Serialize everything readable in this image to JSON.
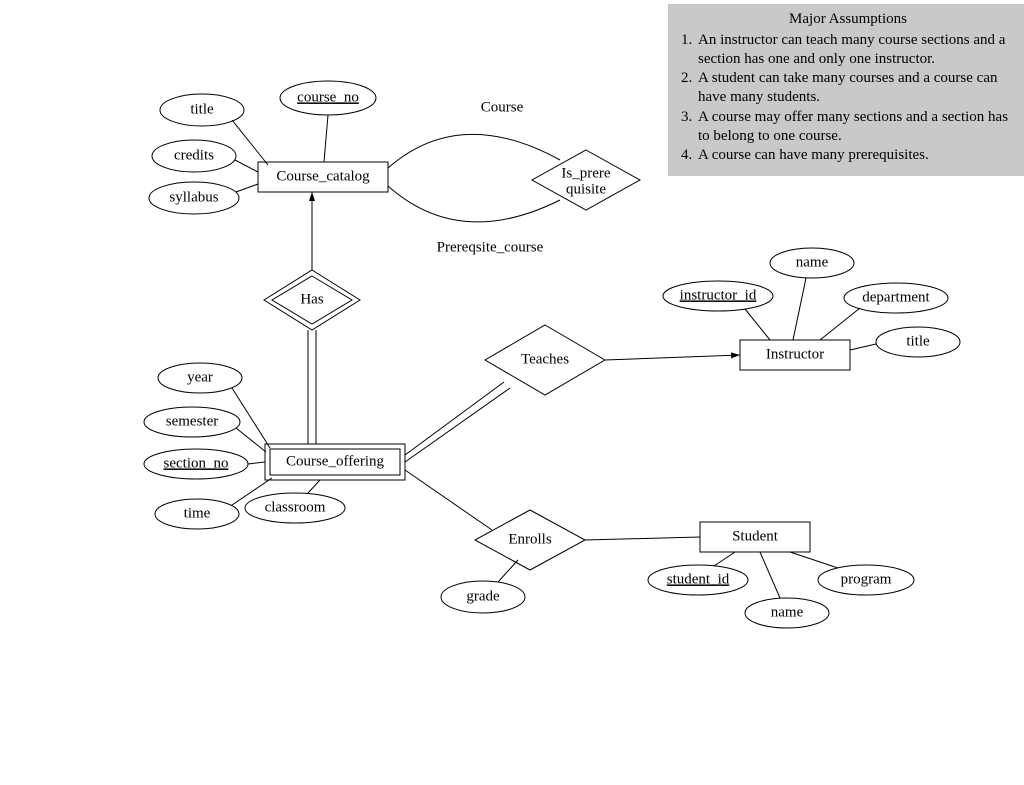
{
  "assumptions": {
    "title": "Major Assumptions",
    "items": [
      "An instructor can teach many course sections and a section has one and only one instructor.",
      "A student can take many courses and a course can have many students.",
      "A course may offer many sections and a section has to belong to one course.",
      "A course can have many prerequisites."
    ]
  },
  "entities": {
    "course_catalog": "Course_catalog",
    "course_offering": "Course_offering",
    "instructor": "Instructor",
    "student": "Student"
  },
  "relationships": {
    "is_prerequisite_l1": "Is_prere",
    "is_prerequisite_l2": "quisite",
    "has": "Has",
    "teaches": "Teaches",
    "enrolls": "Enrolls"
  },
  "role_labels": {
    "course": "Course",
    "prereq_course": "Prereqsite_course"
  },
  "attributes": {
    "course_no": "course_no",
    "title": "title",
    "credits": "credits",
    "syllabus": "syllabus",
    "year": "year",
    "semester": "semester",
    "section_no": "section_no",
    "time": "time",
    "classroom": "classroom",
    "grade": "grade",
    "instructor_id": "instructor_id",
    "inst_name": "name",
    "department": "department",
    "inst_title": "title",
    "student_id": "student_id",
    "stud_name": "name",
    "program": "program"
  }
}
